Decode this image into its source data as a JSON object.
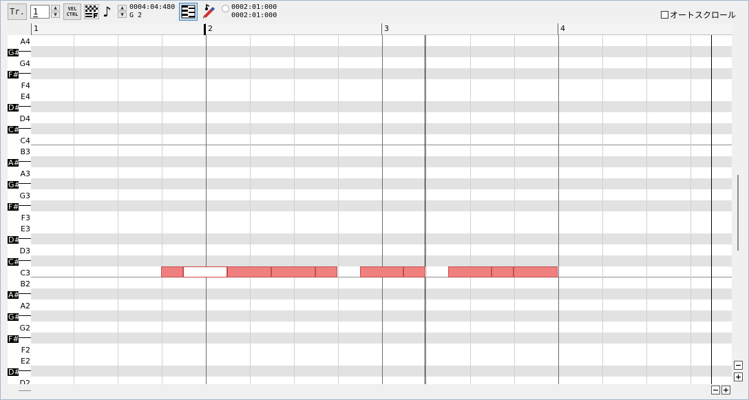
{
  "toolbar": {
    "track_button": "Tr.",
    "track_number": "1",
    "vel_ctrl_top": "VEL",
    "vel_ctrl_bottom": "CTRL",
    "note_glyph": "♪",
    "position_time": "0004:04:480",
    "position_pitch": "G 2",
    "range_start": "0002:01:000",
    "range_end": "0002:01:000",
    "autoscroll_label": "オートスクロール",
    "autoscroll_checked": false
  },
  "ruler": {
    "measures": [
      "1",
      "2",
      "3",
      "4"
    ]
  },
  "keyboard": {
    "labels": [
      "A4",
      "G#",
      "G4",
      "F#",
      "F4",
      "E4",
      "D#",
      "D4",
      "C#",
      "C4",
      "B3",
      "A#",
      "A3",
      "G#",
      "G3",
      "F#",
      "F3",
      "E3",
      "D#",
      "D3",
      "C#",
      "C3",
      "B2",
      "A#",
      "A2",
      "G#",
      "G2",
      "F#",
      "F2",
      "E2",
      "D#",
      "D2"
    ]
  },
  "notes": {
    "pitch": "C3",
    "selected_index": 1,
    "count": 10
  },
  "zoom": {
    "minus": "−",
    "plus": "+"
  },
  "colors": {
    "note_fill": "#f08080",
    "note_border": "#c05050",
    "lane_shade": "#e2e2e2",
    "selected_button": "#cce4f7"
  },
  "icons": [
    "spin-up-icon",
    "spin-down-icon",
    "grid-snap-icon",
    "note-length-icon",
    "piano-roll-icon",
    "pencil-icon",
    "zoom-minus-icon",
    "zoom-plus-icon"
  ]
}
